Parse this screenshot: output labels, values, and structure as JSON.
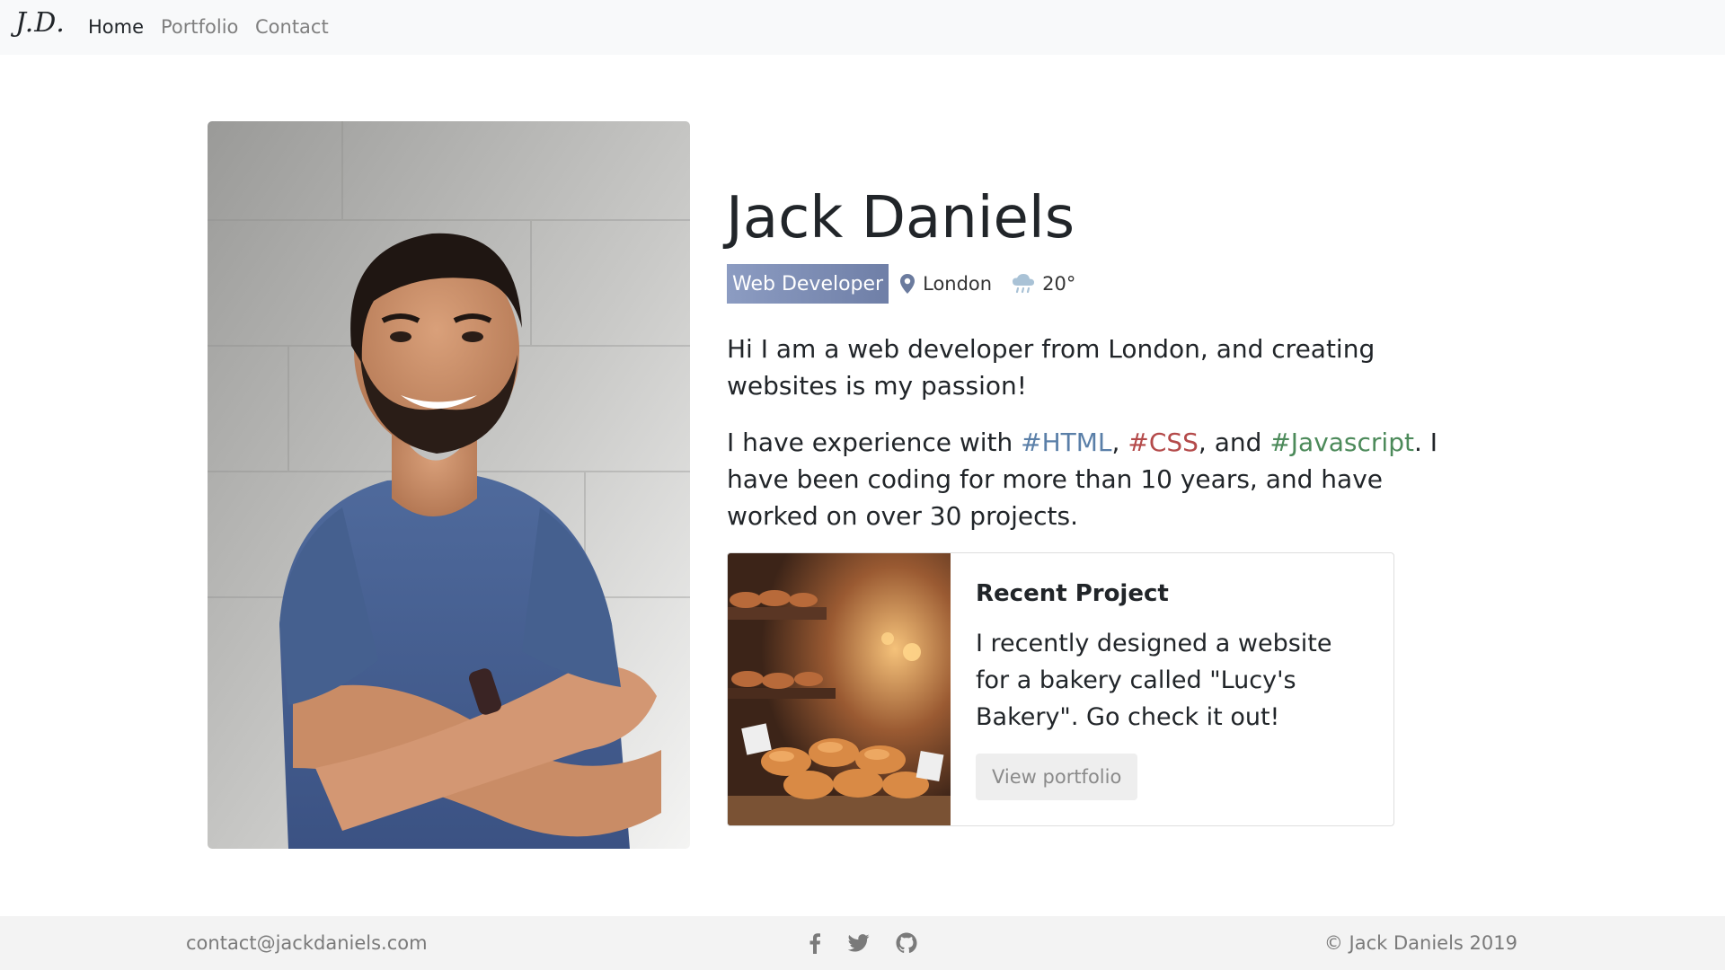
{
  "navbar": {
    "brand": "J.D.",
    "links": [
      {
        "label": "Home",
        "active": true
      },
      {
        "label": "Portfolio",
        "active": false
      },
      {
        "label": "Contact",
        "active": false
      }
    ]
  },
  "profile": {
    "name": "Jack Daniels",
    "role": "Web Developer",
    "location": "London",
    "temperature": "20°",
    "icons": {
      "location": "map-pin-icon",
      "weather": "rain-cloud-icon"
    },
    "intro": "Hi I am a web developer from London, and creating websites is my passion!",
    "experience": {
      "prefix": "I have experience with ",
      "tags": [
        "#HTML",
        "#CSS",
        "#Javascript"
      ],
      "sep1": ", ",
      "sep2": ", and ",
      "suffix": ". I have been coding for more than 10 years, and have worked on over 30 projects."
    }
  },
  "recent_project": {
    "title": "Recent Project",
    "text": "I recently designed a website for a bakery called \"Lucy's Bakery\". Go check it out!",
    "button_label": "View portfolio"
  },
  "footer": {
    "email": "contact@jackdaniels.com",
    "social_icons": [
      "facebook-icon",
      "twitter-icon",
      "github-icon"
    ],
    "copyright": "© Jack Daniels 2019"
  },
  "colors": {
    "navbar_bg": "#f8f9fa",
    "badge": "#7b8bb3",
    "tag_html": "#5a7fa8",
    "tag_css": "#b44a4a",
    "tag_js": "#4c8a5a",
    "footer_bg": "#f3f3f3"
  }
}
